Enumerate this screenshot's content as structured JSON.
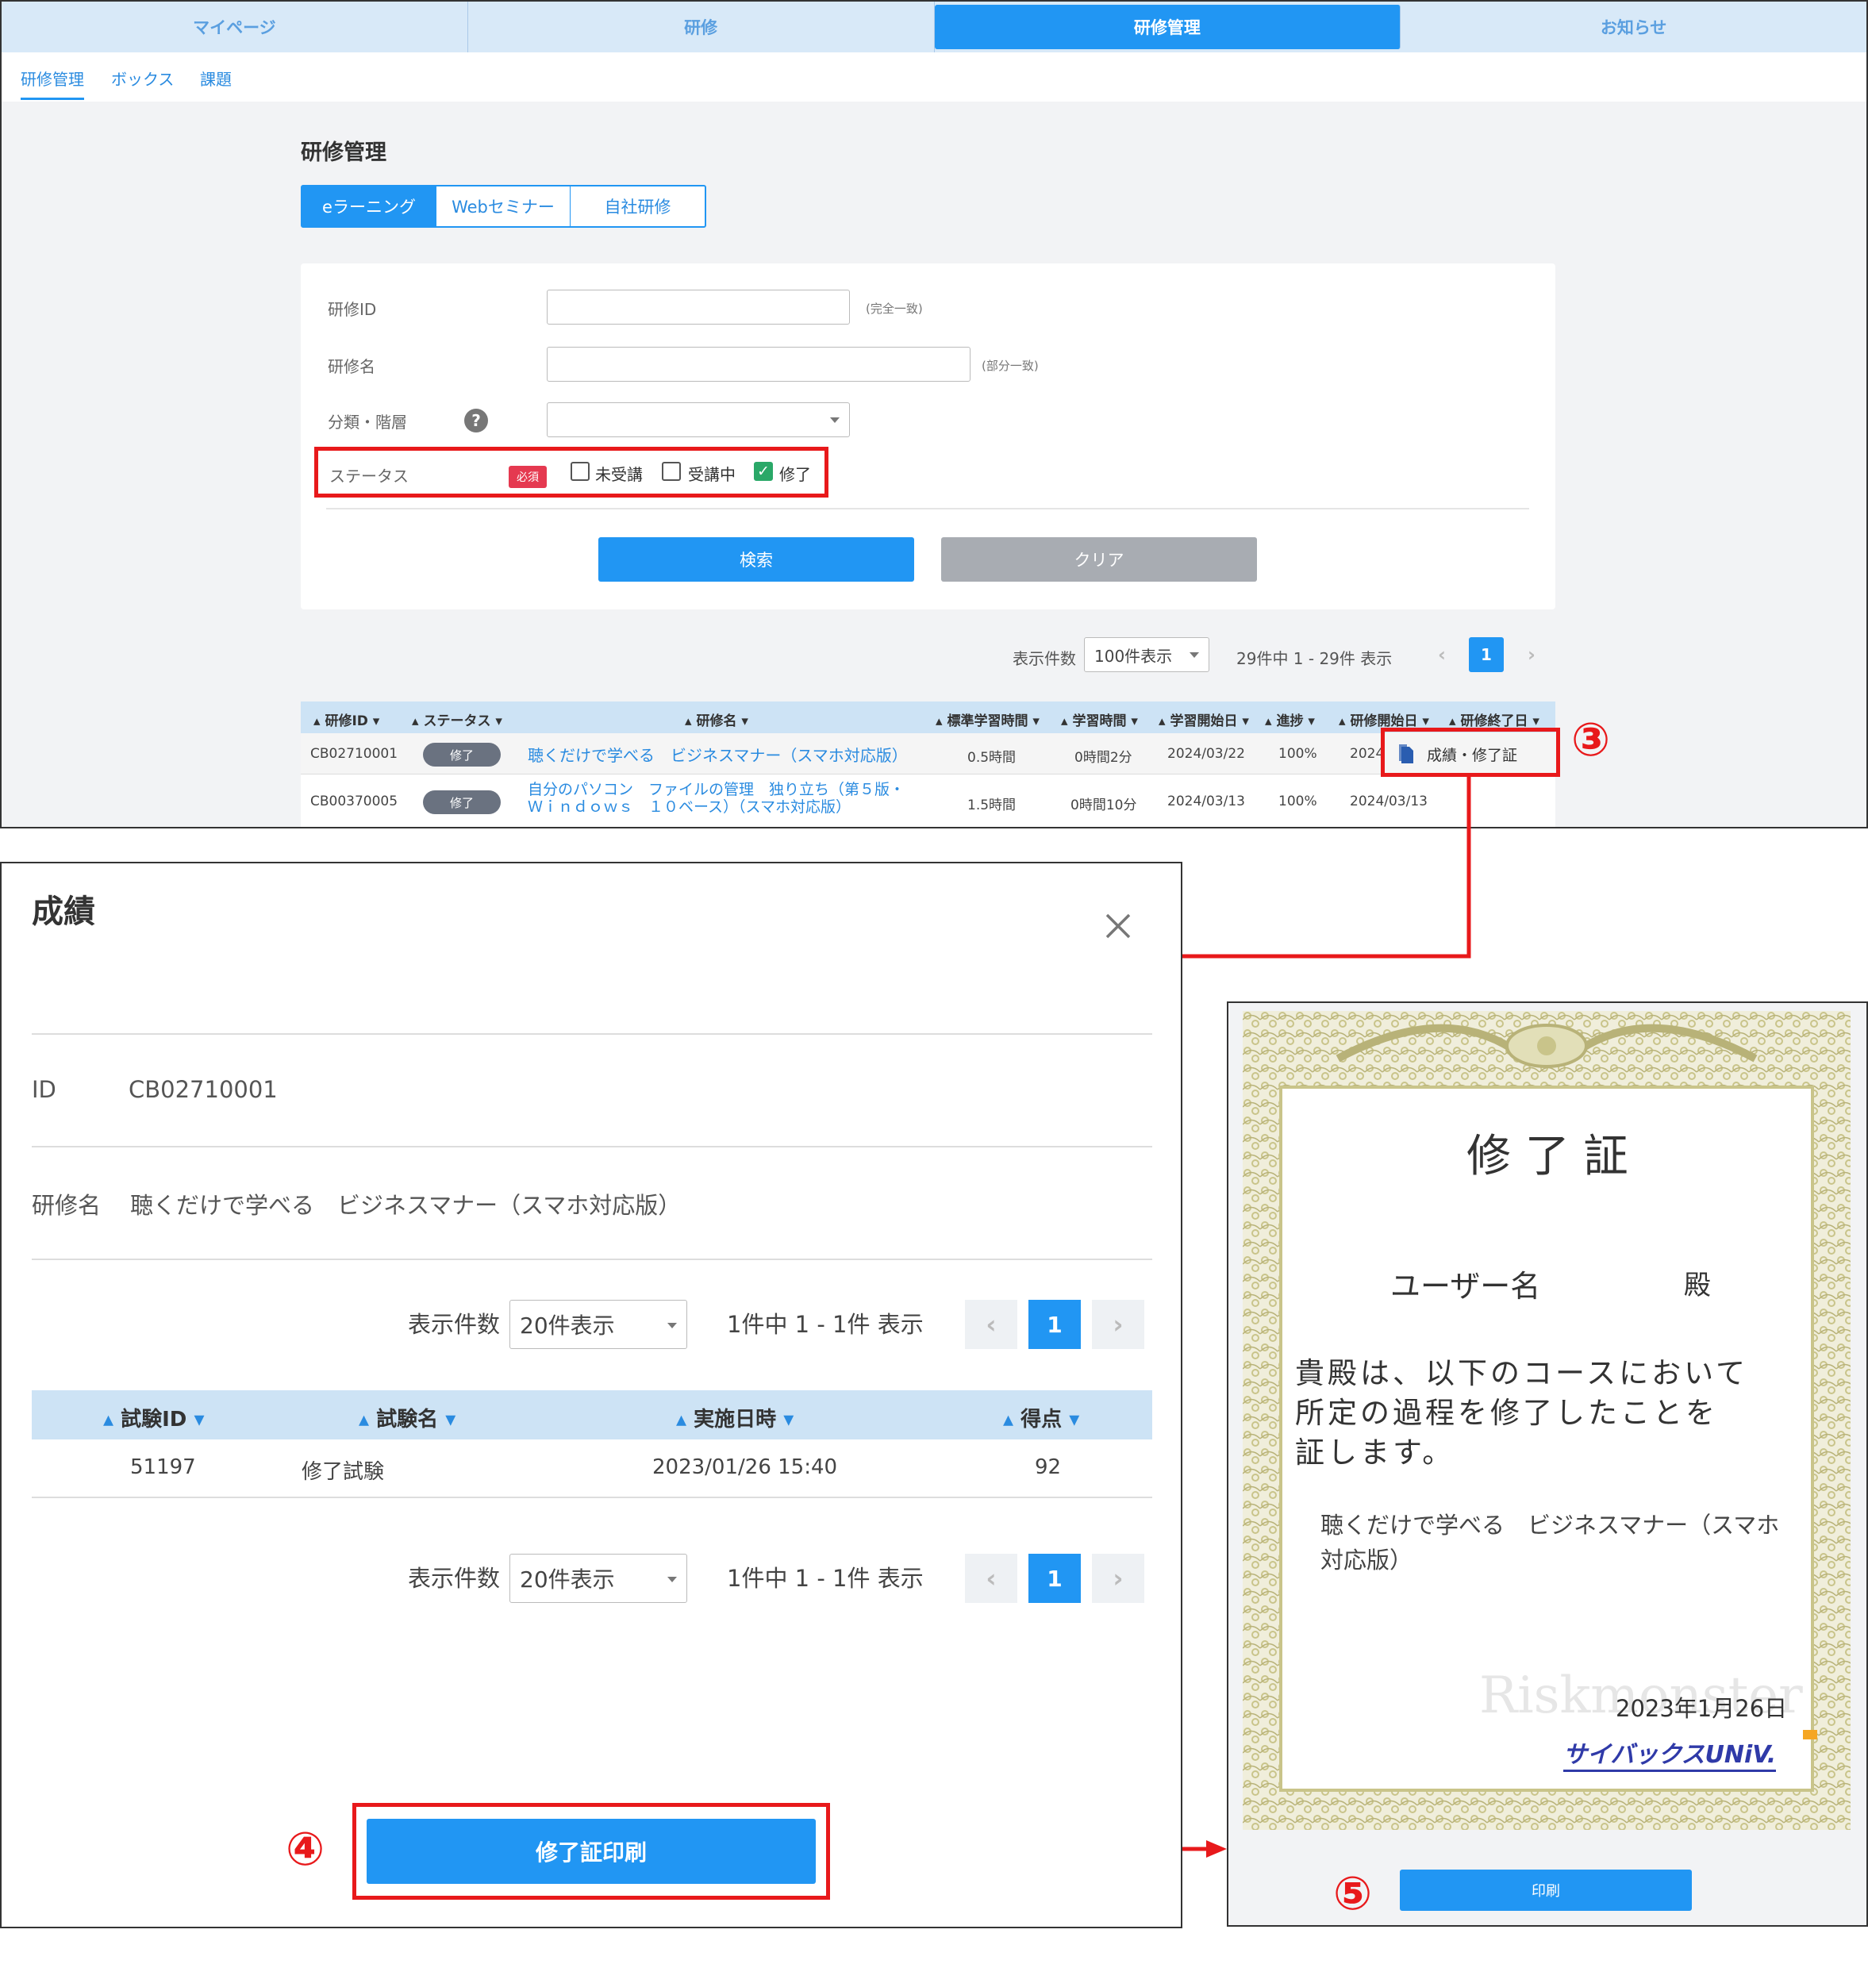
{
  "top_nav": {
    "tabs": [
      "マイページ",
      "研修",
      "研修管理",
      "お知らせ"
    ]
  },
  "sub_nav": {
    "items": [
      "研修管理",
      "ボックス",
      "課題"
    ]
  },
  "page": {
    "title": "研修管理",
    "mode_tabs": [
      "eラーニング",
      "Webセミナー",
      "自社研修"
    ]
  },
  "search": {
    "id_label": "研修ID",
    "id_note": "(完全一致)",
    "name_label": "研修名",
    "name_note": "(部分一致)",
    "category_label": "分類・階層",
    "help_glyph": "?",
    "status_label": "ステータス",
    "required_badge": "必須",
    "status_options": [
      {
        "label": "未受講",
        "checked": false
      },
      {
        "label": "受講中",
        "checked": false
      },
      {
        "label": "修了",
        "checked": true
      }
    ],
    "search_button": "検索",
    "clear_button": "クリア"
  },
  "pagination_top": {
    "per_page_label": "表示件数",
    "per_page_value": "100件表示",
    "summary": "29件中 1 - 29件 表示",
    "current_page": "1"
  },
  "results_table": {
    "columns": [
      "研修ID",
      "ステータス",
      "研修名",
      "標準学習時間",
      "学習時間",
      "学習開始日",
      "進捗",
      "研修開始日",
      "研修終了日"
    ],
    "rows": [
      {
        "id": "CB02710001",
        "status": "修了",
        "name": "聴くだけで学べる　ビジネスマナー（スマホ対応版）",
        "std_time": "0.5時間",
        "time": "0時間2分",
        "start": "2024/03/22",
        "progress": "100%",
        "course_start": "2024",
        "action": "成績・修了証"
      },
      {
        "id": "CB00370005",
        "status": "修了",
        "name_line1": "自分のパソコン　ファイルの管理　独り立ち（第５版・",
        "name_line2": "Ｗｉｎｄｏｗｓ　１０ベース）（スマホ対応版）",
        "std_time": "1.5時間",
        "time": "0時間10分",
        "start": "2024/03/13",
        "progress": "100%",
        "course_start": "2024/03/13"
      }
    ]
  },
  "callouts": {
    "three": "③",
    "four": "④",
    "five": "⑤"
  },
  "modal": {
    "title": "成績",
    "id_label": "ID",
    "id_value": "CB02710001",
    "name_label": "研修名",
    "name_value": "聴くだけで学べる　ビジネスマナー（スマホ対応版）",
    "pagination": {
      "per_page_label": "表示件数",
      "per_page_value": "20件表示",
      "summary": "1件中 1 - 1件 表示",
      "current_page": "1"
    },
    "table": {
      "columns": [
        "試験ID",
        "試験名",
        "実施日時",
        "得点"
      ],
      "rows": [
        {
          "exam_id": "51197",
          "exam_name": "修了試験",
          "datetime": "2023/01/26 15:40",
          "score": "92"
        }
      ]
    },
    "print_button": "修了証印刷"
  },
  "certificate": {
    "title": "修 了 証",
    "recipient": "ユーザー名",
    "honorific": "殿",
    "body_lines": [
      "貴殿は、以下のコースにおいて",
      "所定の過程を修了したことを",
      "証します。"
    ],
    "course_line1": "聴くだけで学べる　ビジネスマナー（スマホ",
    "course_line2": "対応版）",
    "watermark": "Riskmonster",
    "date": "2023年1月26日",
    "logo": "サイバックスUNiV.",
    "print_button": "印刷"
  },
  "colors": {
    "accent": "#2196f3",
    "callout": "#e8191b",
    "frame_gold": "#c9c48a"
  }
}
